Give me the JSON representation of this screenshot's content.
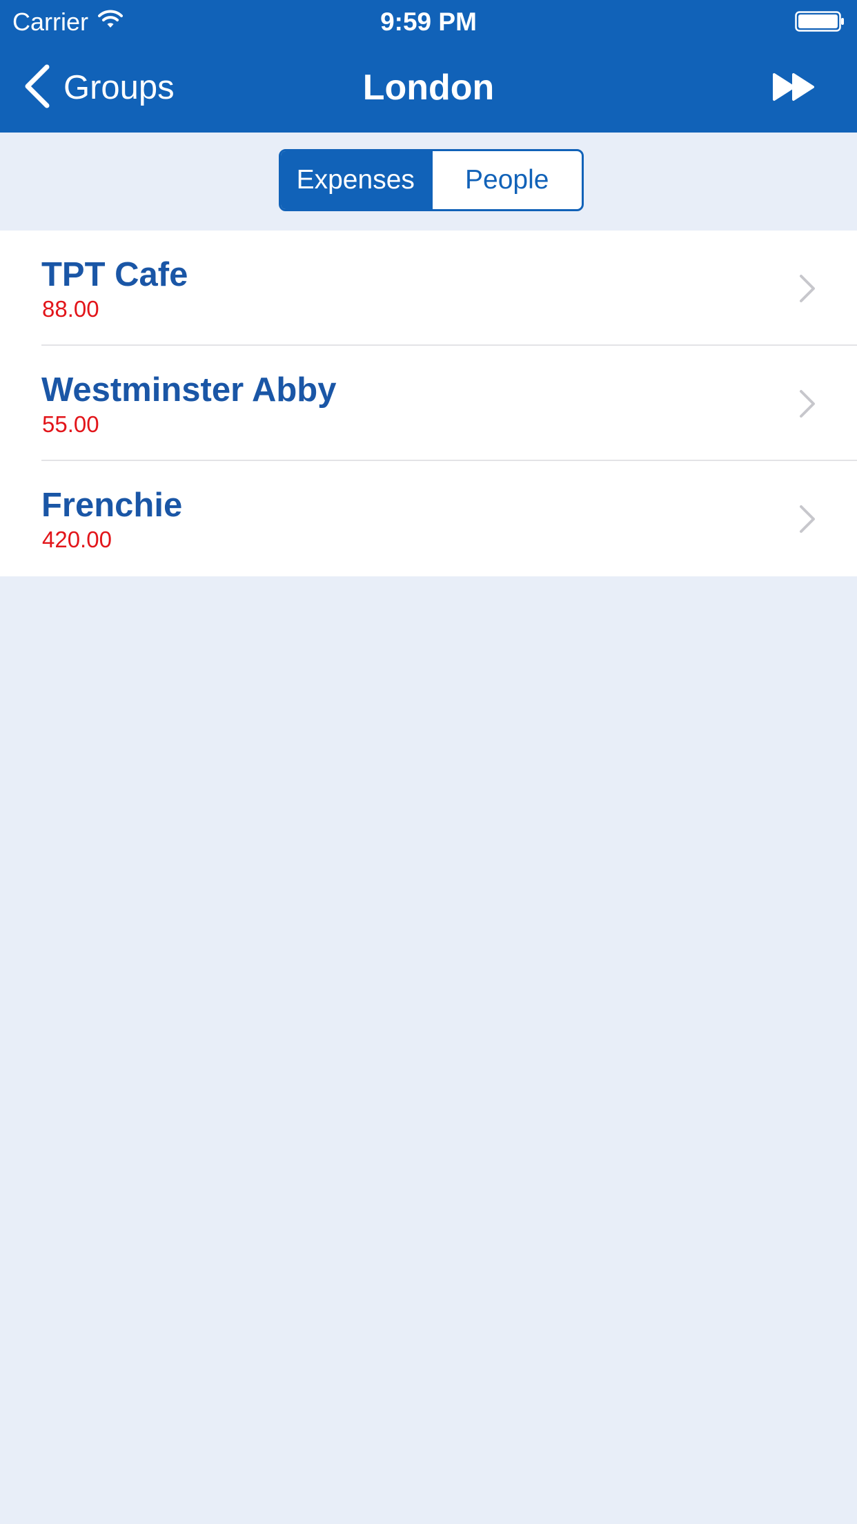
{
  "status_bar": {
    "carrier": "Carrier",
    "time": "9:59 PM"
  },
  "nav": {
    "back_label": "Groups",
    "title": "London"
  },
  "segments": [
    {
      "label": "Expenses",
      "selected": true
    },
    {
      "label": "People",
      "selected": false
    }
  ],
  "expenses": [
    {
      "name": "TPT Cafe",
      "amount": "88.00"
    },
    {
      "name": "Westminster Abby",
      "amount": "55.00"
    },
    {
      "name": "Frenchie",
      "amount": "420.00"
    }
  ],
  "colors": {
    "nav_background": "#1162b8",
    "page_background": "#e8eef8",
    "title_text": "#1a56a6",
    "amount_text": "#e2151a",
    "chevron": "#c7c7cc"
  },
  "icons": {
    "wifi": "wifi-icon",
    "battery": "battery-icon",
    "back": "chevron-left-icon",
    "action": "fast-forward-icon",
    "disclosure": "chevron-right-icon"
  }
}
